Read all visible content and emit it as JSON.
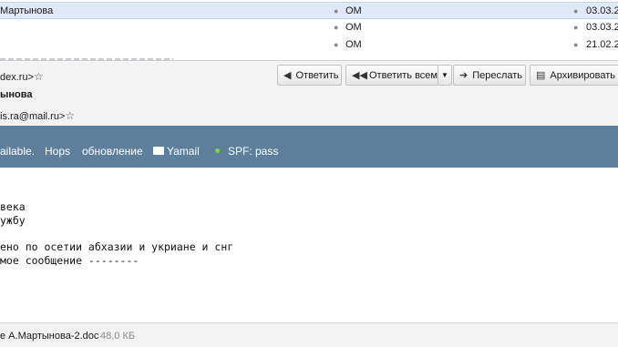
{
  "message_list": {
    "rows": [
      {
        "sender": "Мартынова",
        "account": "OM",
        "date": "03.03.2"
      },
      {
        "sender": "",
        "account": "OM",
        "date": "03.03.2"
      },
      {
        "sender": "",
        "account": "OM",
        "date": "21.02.2"
      }
    ]
  },
  "header": {
    "from": "dex.ru>",
    "sender_name": "ынова",
    "to": "is.ra@mail.ru>"
  },
  "toolbar": {
    "reply": "Ответить",
    "reply_all": "Ответить всем",
    "forward": "Переслать",
    "archive": "Архивировать"
  },
  "banner": {
    "item1": "ailable.",
    "item2": "Hops",
    "item3": "обновление",
    "item4": "Yamail",
    "item5": "SPF: pass"
  },
  "body": {
    "line1": "века",
    "line2": "ужбу",
    "line3": "",
    "line4": "ено по осетии абхазии и укриане и снг",
    "line5": "мое сообщение --------"
  },
  "attachment": {
    "name": "е А.Мартынова-2.doc",
    "size": "48,0 КБ"
  },
  "colors": {
    "banner": "#5d7f9c",
    "selected_row": "#dfe9f8",
    "spf_dot": "#7fd34e"
  },
  "icons": [
    "star-icon",
    "reply-icon",
    "reply-all-icon",
    "chevron-down-icon",
    "forward-icon",
    "archive-icon",
    "mail-icon"
  ]
}
